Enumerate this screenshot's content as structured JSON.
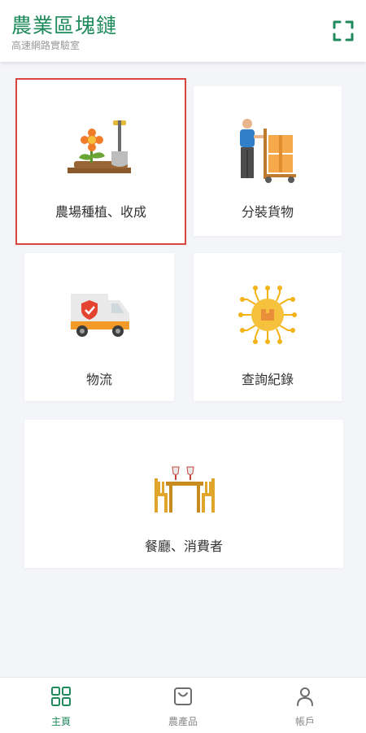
{
  "header": {
    "title": "農業區塊鏈",
    "subtitle": "高速網路實驗室",
    "scan_icon": "scan-icon"
  },
  "cards": [
    {
      "label": "農場種植、收成",
      "icon": "planting-shovel-icon",
      "selected": true
    },
    {
      "label": "分裝貨物",
      "icon": "worker-hand-truck-icon",
      "selected": false
    },
    {
      "label": "物流",
      "icon": "delivery-truck-icon",
      "selected": false
    },
    {
      "label": "查詢紀錄",
      "icon": "blockchain-chip-icon",
      "selected": false
    },
    {
      "label": "餐廳、消費者",
      "icon": "restaurant-table-icon",
      "selected": false
    }
  ],
  "tabs": [
    {
      "label": "主頁",
      "icon": "grid-icon",
      "active": true
    },
    {
      "label": "農產品",
      "icon": "shopping-bag-icon",
      "active": false
    },
    {
      "label": "帳戶",
      "icon": "user-icon",
      "active": false
    }
  ],
  "colors": {
    "brand": "#1f8a5b",
    "selected_outline": "#d9463f",
    "background": "#f4f5f9"
  }
}
